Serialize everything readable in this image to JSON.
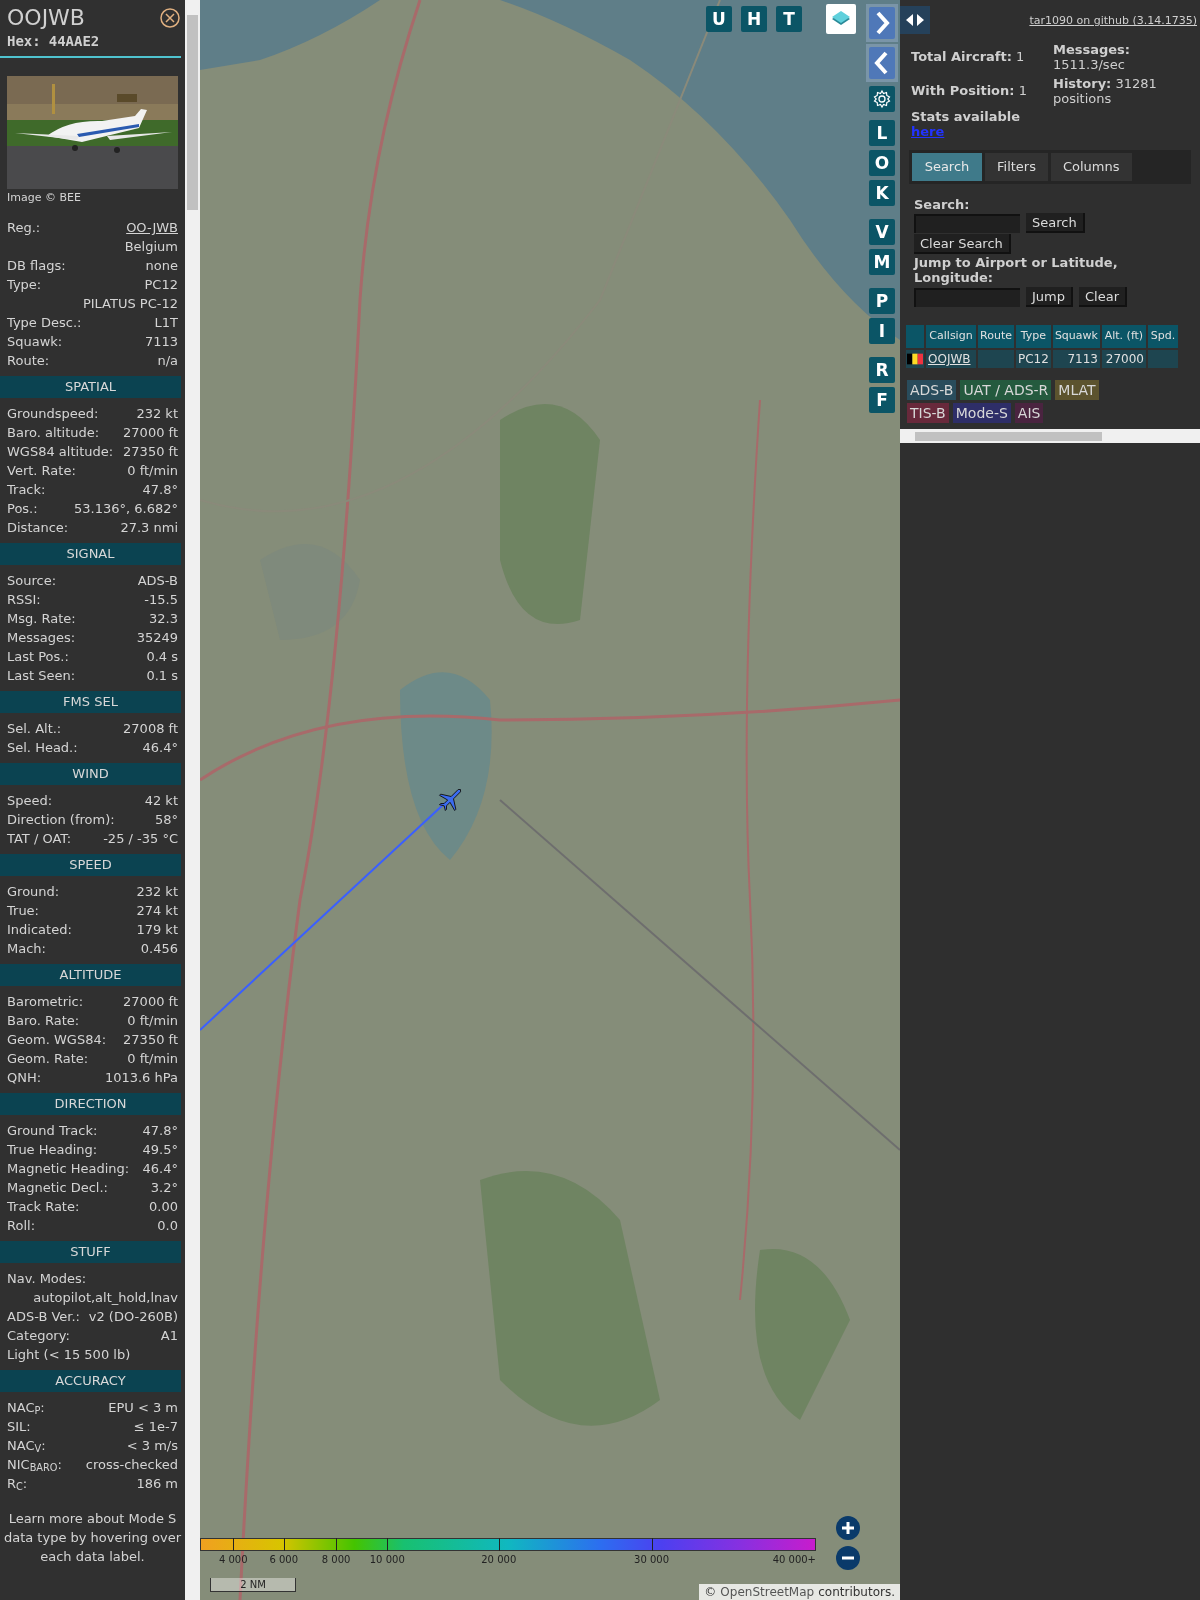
{
  "aircraft": {
    "callsign": "OOJWB",
    "hex_label": "Hex:",
    "hex": "44AAE2"
  },
  "photo": {
    "credit": "Image © BEE"
  },
  "details": [
    {
      "label": "Reg.:",
      "value": "OO-JWB",
      "link": true
    },
    {
      "value": "Belgium"
    },
    {
      "label": "DB flags:",
      "value": "none"
    },
    {
      "label": "Type:",
      "value": "PC12"
    },
    {
      "value": "PILATUS PC-12"
    },
    {
      "label": "Type Desc.:",
      "value": "L1T"
    },
    {
      "label": "Squawk:",
      "value": "7113"
    },
    {
      "label": "Route:",
      "value": "n/a"
    }
  ],
  "sections": [
    {
      "title": "SPATIAL",
      "rows": [
        {
          "label": "Groundspeed:",
          "value": "232 kt"
        },
        {
          "label": "Baro. altitude:",
          "value": "27000 ft"
        },
        {
          "label": "WGS84 altitude:",
          "value": "27350 ft"
        },
        {
          "label": "Vert. Rate:",
          "value": "0 ft/min"
        },
        {
          "label": "Track:",
          "value": "47.8°"
        },
        {
          "label": "Pos.:",
          "value": "53.136°, 6.682°"
        },
        {
          "label": "Distance:",
          "value": "27.3 nmi"
        }
      ]
    },
    {
      "title": "SIGNAL",
      "rows": [
        {
          "label": "Source:",
          "value": "ADS-B"
        },
        {
          "label": "RSSI:",
          "value": "-15.5"
        },
        {
          "label": "Msg. Rate:",
          "value": "32.3"
        },
        {
          "label": "Messages:",
          "value": "35249"
        },
        {
          "label": "Last Pos.:",
          "value": "0.4 s"
        },
        {
          "label": "Last Seen:",
          "value": "0.1 s"
        }
      ]
    },
    {
      "title": "FMS SEL",
      "rows": [
        {
          "label": "Sel. Alt.:",
          "value": "27008 ft"
        },
        {
          "label": "Sel. Head.:",
          "value": "46.4°"
        }
      ]
    },
    {
      "title": "WIND",
      "rows": [
        {
          "label": "Speed:",
          "value": "42 kt"
        },
        {
          "label": "Direction (from):",
          "value": "58°"
        },
        {
          "label": "TAT / OAT:",
          "value": "-25 / -35 °C"
        }
      ]
    },
    {
      "title": "SPEED",
      "rows": [
        {
          "label": "Ground:",
          "value": "232 kt"
        },
        {
          "label": "True:",
          "value": "274 kt"
        },
        {
          "label": "Indicated:",
          "value": "179 kt"
        },
        {
          "label": "Mach:",
          "value": "0.456"
        }
      ]
    },
    {
      "title": "ALTITUDE",
      "rows": [
        {
          "label": "Barometric:",
          "value": "27000 ft"
        },
        {
          "label": "Baro. Rate:",
          "value": "0 ft/min"
        },
        {
          "label": "Geom. WGS84:",
          "value": "27350 ft"
        },
        {
          "label": "Geom. Rate:",
          "value": "0 ft/min"
        },
        {
          "label": "QNH:",
          "value": "1013.6 hPa"
        }
      ]
    },
    {
      "title": "DIRECTION",
      "rows": [
        {
          "label": "Ground Track:",
          "value": "47.8°"
        },
        {
          "label": "True Heading:",
          "value": "49.5°"
        },
        {
          "label": "Magnetic Heading:",
          "value": "46.4°"
        },
        {
          "label": "Magnetic Decl.:",
          "value": "3.2°"
        },
        {
          "label": "Track Rate:",
          "value": "0.00"
        },
        {
          "label": "Roll:",
          "value": "0.0"
        }
      ]
    },
    {
      "title": "STUFF",
      "rows": [
        {
          "label": "Nav. Modes:"
        },
        {
          "value": "autopilot,alt_hold,lnav"
        },
        {
          "label": "ADS-B Ver.:",
          "value": "v2 (DO-260B)"
        },
        {
          "label": "Category:",
          "value": "A1"
        },
        {
          "label": "Light (< 15 500 lb)"
        }
      ]
    },
    {
      "title": "ACCURACY",
      "rows": [
        {
          "label": "NAC$_{P}$:",
          "value": "EPU < 3 m"
        },
        {
          "label": "SIL:",
          "value": "≤ 1e-7"
        },
        {
          "label": "NAC$_{V}$:",
          "value": "< 3 m/s"
        },
        {
          "label": "NIC$_{BARO}$:",
          "value": "cross-checked"
        },
        {
          "label": "R$_{C}$:",
          "value": "186 m"
        }
      ]
    }
  ],
  "footnote": "Learn more about Mode S data type by hovering over each data label.",
  "map": {
    "top_buttons": [
      "U",
      "H",
      "T"
    ],
    "side_button_groups": [
      [
        "L",
        "O",
        "K"
      ],
      [
        "V",
        "M"
      ],
      [
        "P",
        "I"
      ],
      [
        "R",
        "F"
      ]
    ],
    "legend_labels": [
      "4 000",
      "6 000",
      "8 000",
      "10 000",
      "20 000",
      "30 000",
      "40 000+"
    ],
    "scale": "2 NM",
    "attribution": {
      "prefix": "©",
      "link": "OpenStreetMap",
      "suffix": "contributors."
    }
  },
  "panel": {
    "header_link": "tar1090 on github (3.14.1735)",
    "stats_left": [
      "**Total Aircraft:** 1",
      "**With Position:** 1"
    ],
    "stats_right": [
      "**Messages:** 1511.3/sec",
      "**History:** 31281 positions"
    ],
    "stats_note": {
      "text": "Stats available",
      "link": "here"
    },
    "tabs": [
      {
        "label": "Search",
        "selected": true
      },
      {
        "label": "Filters",
        "selected": false
      },
      {
        "label": "Columns",
        "selected": false
      }
    ],
    "search": {
      "label": "Search:",
      "button": "Search",
      "clear_button": "Clear Search"
    },
    "jump": {
      "label": "Jump to Airport or Latitude, Longitude:",
      "button": "Jump",
      "clear_button": "Clear"
    },
    "table": {
      "columns": [
        "Callsign",
        "Route",
        "Type",
        "Squawk",
        "Alt. (ft)",
        "Spd."
      ],
      "rows": [
        {
          "callsign": "OOJWB",
          "type": "PC12",
          "squawk": "7113",
          "altitude": "27000"
        }
      ]
    },
    "sources": [
      {
        "label": "ADS-B",
        "color": "#294c5c"
      },
      {
        "label": "UAT / ADS-R",
        "color": "#245a3e"
      },
      {
        "label": "MLAT",
        "color": "#5c532e"
      },
      {
        "label": "TIS-B",
        "color": "#68293b"
      },
      {
        "label": "Mode-S",
        "color": "#2e2e68"
      },
      {
        "label": "AIS",
        "color": "#4a2440"
      }
    ]
  }
}
